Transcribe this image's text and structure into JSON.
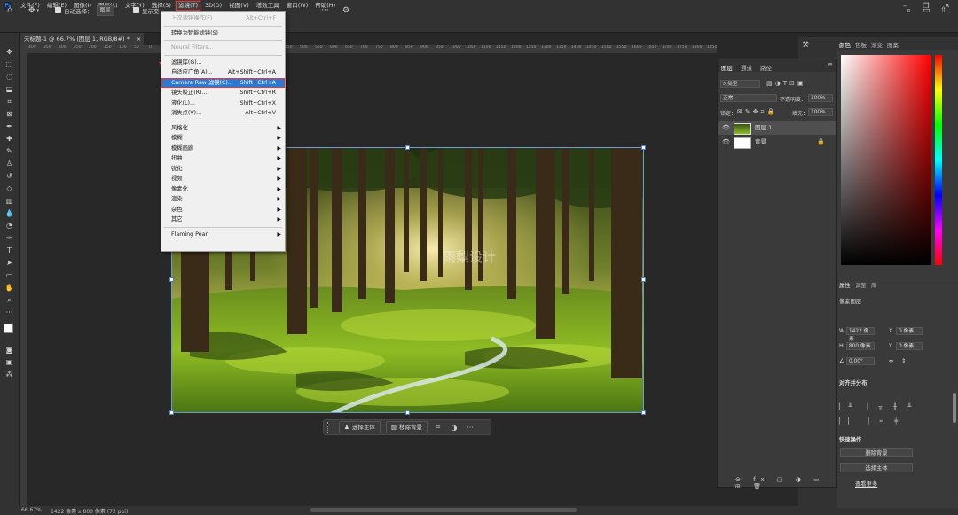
{
  "menubar": {
    "items": [
      "文件(F)",
      "编辑(E)",
      "图像(I)",
      "图层(L)",
      "文字(Y)",
      "选择(S)",
      "滤镜(T)",
      "3D(D)",
      "视图(V)",
      "增效工具",
      "窗口(W)",
      "帮助(H)"
    ],
    "active_index": 6
  },
  "options": {
    "auto_select_label": "自动选择：",
    "auto_select_value": "图层",
    "show_transform_label": "显示变"
  },
  "document": {
    "tab_title": "未标题-1 @ 66.7% (图层 1, RGB/8#) *",
    "close": "×"
  },
  "ruler_marks": [
    "400",
    "350",
    "300",
    "250",
    "200",
    "150",
    "100",
    "50",
    "0",
    "50",
    "100",
    "150",
    "200",
    "250",
    "300",
    "350",
    "400",
    "450",
    "500",
    "550",
    "600",
    "650",
    "700",
    "750",
    "800",
    "850",
    "900",
    "950",
    "1000",
    "1050",
    "1100",
    "1150",
    "1200",
    "1250",
    "1300",
    "1350",
    "1400",
    "1450",
    "1500",
    "1550",
    "1600",
    "1650",
    "1700",
    "1750",
    "1800",
    "1850"
  ],
  "watermark": "雨梨设计",
  "filter_menu": {
    "rows": [
      {
        "label": "上次滤镜操作(F)",
        "shortcut": "Alt+Ctrl+F",
        "disabled": true
      },
      {
        "sep": true
      },
      {
        "label": "转换为智能滤镜(S)",
        "shortcut": ""
      },
      {
        "sep": true
      },
      {
        "label": "Neural Filters...",
        "shortcut": "",
        "disabled": true
      },
      {
        "sep": true
      },
      {
        "label": "滤镜库(G)...",
        "shortcut": ""
      },
      {
        "label": "自适应广角(A)...",
        "shortcut": "Alt+Shift+Ctrl+A"
      },
      {
        "label": "Camera Raw 滤镜(C)...",
        "shortcut": "Shift+Ctrl+A",
        "highlight": true
      },
      {
        "label": "镜头校正(R)...",
        "shortcut": "Shift+Ctrl+R"
      },
      {
        "label": "液化(L)...",
        "shortcut": "Shift+Ctrl+X"
      },
      {
        "label": "消失点(V)...",
        "shortcut": "Alt+Ctrl+V"
      },
      {
        "sep": true
      },
      {
        "label": "风格化",
        "submenu": true
      },
      {
        "label": "模糊",
        "submenu": true
      },
      {
        "label": "模糊画廊",
        "submenu": true
      },
      {
        "label": "扭曲",
        "submenu": true
      },
      {
        "label": "锐化",
        "submenu": true
      },
      {
        "label": "视频",
        "submenu": true
      },
      {
        "label": "像素化",
        "submenu": true
      },
      {
        "label": "渲染",
        "submenu": true
      },
      {
        "label": "杂色",
        "submenu": true
      },
      {
        "label": "其它",
        "submenu": true
      },
      {
        "sep": true
      },
      {
        "label": "Flaming Pear",
        "submenu": true
      }
    ]
  },
  "context_bar": {
    "select_subject": "选择主体",
    "remove_bg": "移除背景",
    "more": "···"
  },
  "status": {
    "zoom": "66.67%",
    "doc_info": "1422 像素 x 800 像素 (72 ppi)"
  },
  "layers_panel": {
    "tabs": [
      "图层",
      "通道",
      "路径"
    ],
    "filter_kind": "类型",
    "blend_mode": "正常",
    "opacity_label": "不透明度：",
    "opacity_value": "100%",
    "lock_label": "锁定：",
    "fill_label": "填充：",
    "fill_value": "100%",
    "layers": [
      {
        "name": "图层 1",
        "selected": true
      },
      {
        "name": "背景",
        "locked": true
      }
    ]
  },
  "color_panel": {
    "tabs": [
      "颜色",
      "色板",
      "渐变",
      "图案"
    ]
  },
  "props_panel": {
    "tabs": [
      "属性",
      "调整",
      "库"
    ],
    "section_title": "像素图层",
    "w_label": "W",
    "w_value": "1422 像素",
    "h_label": "H",
    "h_value": "800 像素",
    "x_label": "X",
    "x_value": "0 像素",
    "y_label": "Y",
    "y_value": "0 像素",
    "angle_value": "0.00°",
    "align_title": "对齐并分布",
    "ops_title": "快速操作",
    "op1": "删除背景",
    "op2": "选择主体",
    "more": "查看更多"
  },
  "colors": {
    "accent_blue": "#2b79d0",
    "annotation_red": "#e0393e"
  }
}
